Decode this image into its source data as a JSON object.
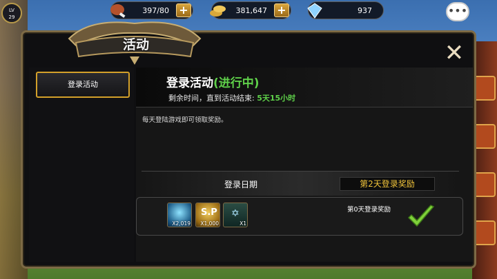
{
  "hud": {
    "level": "LV\n29",
    "stamina": "397/80",
    "gold": "381,647",
    "gems": "937",
    "plus": "+"
  },
  "panel": {
    "title": "活动",
    "close": "✕"
  },
  "sidebar": {
    "tabs": [
      {
        "label": "登录活动"
      }
    ]
  },
  "event": {
    "title": "登录活动",
    "status": "(进行中)",
    "remain_prefix": "剩余时间，直到活动结束:",
    "remain_time": "5天15小时",
    "description": "每天登陆游戏即可领取奖励。",
    "date_header": "登录日期",
    "reward_header": "第2天登录奖励"
  },
  "rewards": {
    "day_label": "第0天登录奖励",
    "items": [
      {
        "icon": "crystal-icon",
        "qty": "X2,019"
      },
      {
        "icon": "sp-icon",
        "label": "S.P",
        "qty": "X1,000"
      },
      {
        "icon": "skill-book-icon",
        "qty": "X1"
      }
    ],
    "claimed": true
  },
  "colors": {
    "accent_green": "#5fd14a",
    "accent_gold": "#f0c33a",
    "frame": "#7d6a45"
  }
}
